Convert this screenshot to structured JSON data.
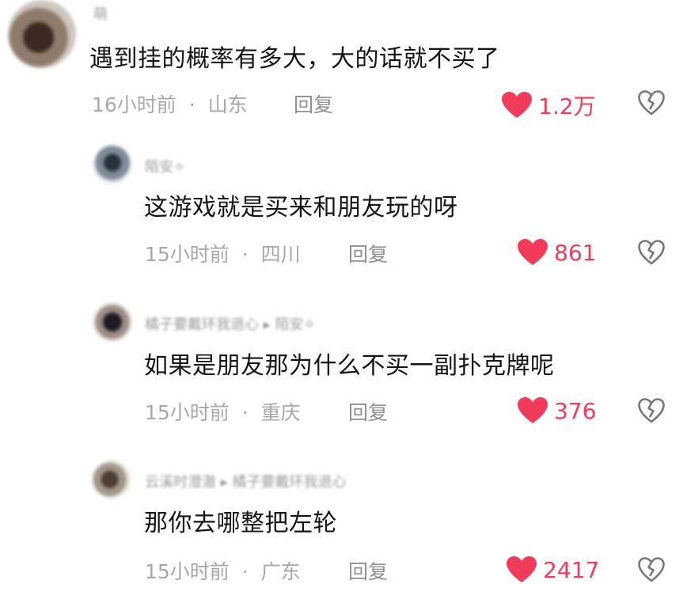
{
  "colors": {
    "like_red": "#f03c5a",
    "meta_gray": "#a8a8a8",
    "text": "#151515"
  },
  "comments": [
    {
      "name": "萌",
      "text": "遇到挂的概率有多大，大的话就不买了",
      "time": "16小时前",
      "location": "山东",
      "reply_label": "回复",
      "likes": "1.2万"
    },
    {
      "name": "陌安✧",
      "text": "这游戏就是买来和朋友玩的呀",
      "time": "15小时前",
      "location": "四川",
      "reply_label": "回复",
      "likes": "861"
    },
    {
      "name": "橘子要戴环我退心 ▸ 陌安✧",
      "text": "如果是朋友那为什么不买一副扑克牌呢",
      "time": "15小时前",
      "location": "重庆",
      "reply_label": "回复",
      "likes": "376"
    },
    {
      "name": "云溪时澄澈 ▸ 橘子要戴环我退心",
      "text": "那你去哪整把左轮",
      "time": "15小时前",
      "location": "广东",
      "reply_label": "回复",
      "likes": "2417"
    }
  ],
  "separator": "·",
  "icons": {
    "like": "heart-icon",
    "dislike": "broken-heart-icon"
  }
}
